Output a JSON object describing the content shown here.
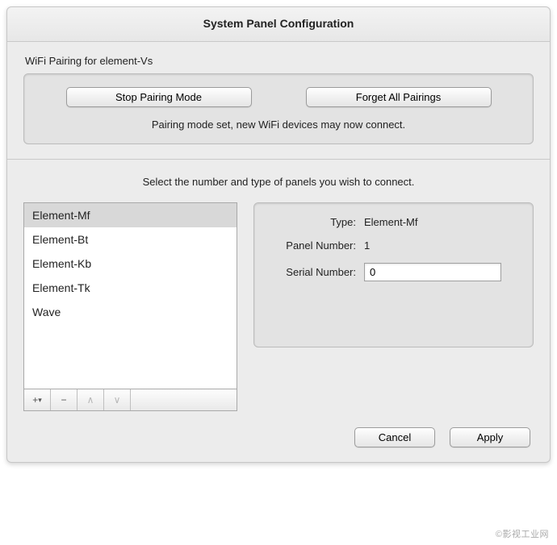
{
  "title": "System Panel Configuration",
  "pairing": {
    "group_label": "WiFi Pairing for element-Vs",
    "stop_label": "Stop Pairing Mode",
    "forget_label": "Forget All Pairings",
    "status": "Pairing mode set, new WiFi devices may now connect."
  },
  "panels": {
    "instruction": "Select the number and type of panels you wish to connect.",
    "list": [
      {
        "label": "Element-Mf",
        "selected": true
      },
      {
        "label": "Element-Bt",
        "selected": false
      },
      {
        "label": "Element-Kb",
        "selected": false
      },
      {
        "label": "Element-Tk",
        "selected": false
      },
      {
        "label": "Wave",
        "selected": false
      }
    ],
    "controls": {
      "add": "+",
      "remove": "−",
      "up": "∧",
      "down": "∨"
    },
    "details": {
      "type_label": "Type:",
      "type_value": "Element-Mf",
      "panel_number_label": "Panel Number:",
      "panel_number_value": "1",
      "serial_number_label": "Serial Number:",
      "serial_number_value": "0"
    }
  },
  "actions": {
    "cancel": "Cancel",
    "apply": "Apply"
  },
  "watermark": "©影视工业网"
}
